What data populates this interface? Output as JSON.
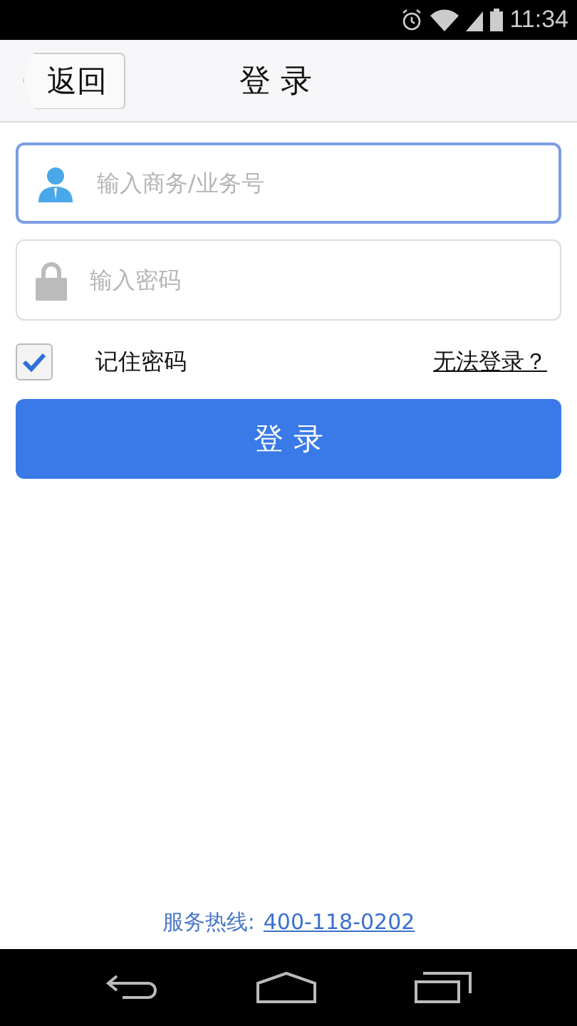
{
  "status_bar": {
    "time": "11:34"
  },
  "header": {
    "back_button": "返回",
    "title": "登 录"
  },
  "fields": [
    {
      "kind": "user",
      "placeholder": "输入商务/业务号",
      "focused": true
    },
    {
      "kind": "lock",
      "placeholder": "输入密码",
      "focused": false
    }
  ],
  "remember": {
    "label": "记住密码",
    "checked": true
  },
  "help_link": "无法登录？",
  "login_button": "登 录",
  "hotline": {
    "label": "服务热线:",
    "number": "400-118-0202"
  }
}
